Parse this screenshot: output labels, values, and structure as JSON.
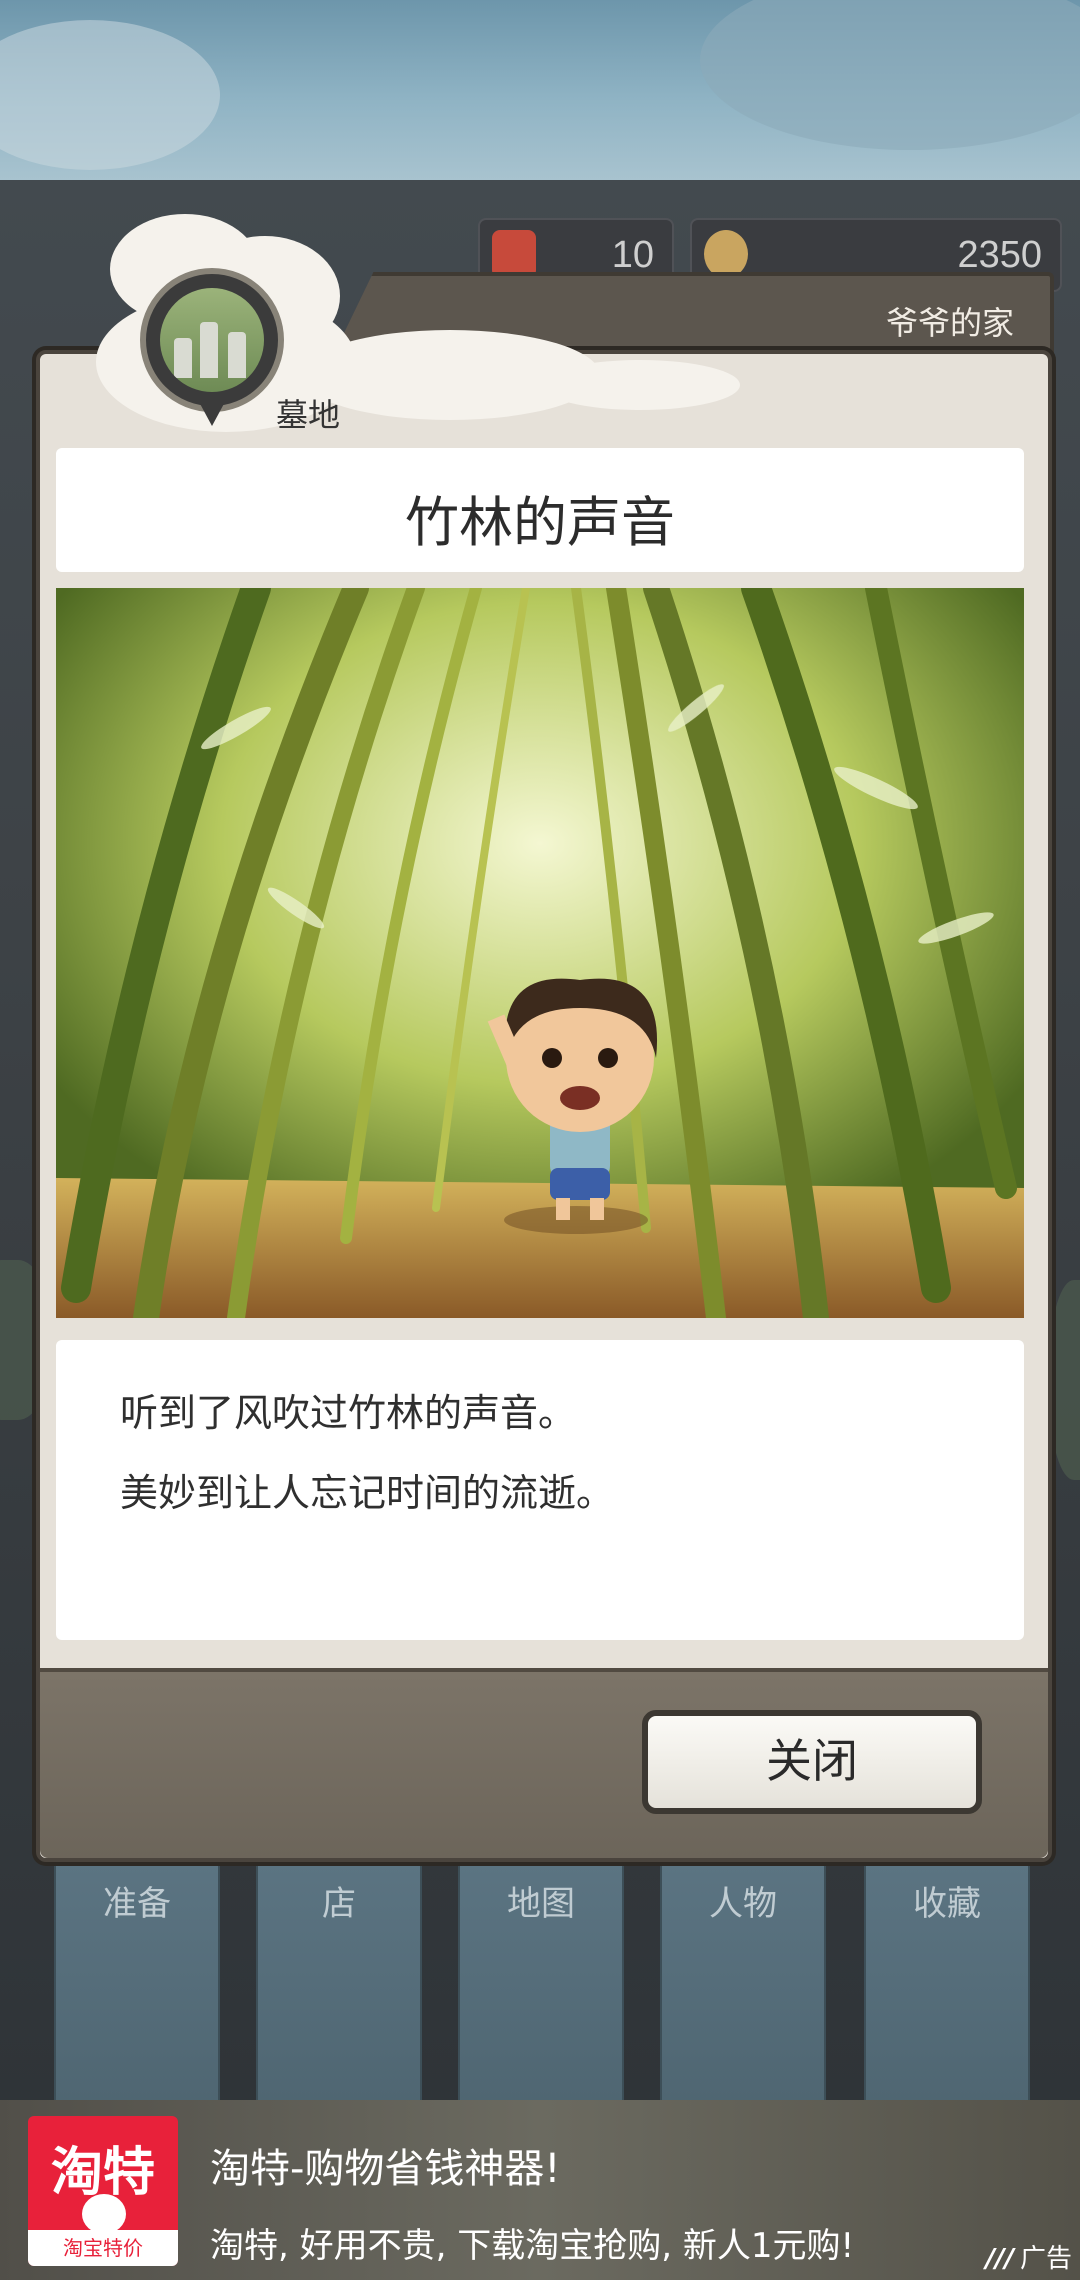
{
  "top_bar": {
    "ticket_count": "10",
    "coin_count": "2350"
  },
  "dialog": {
    "header_location": "爷爷的家",
    "pin_label": "墓地",
    "title": "竹林的声音",
    "description_lines": [
      "听到了风吹过竹林的声音。",
      "美妙到让人忘记时间的流逝。"
    ],
    "close_label": "关闭"
  },
  "bottom_nav": {
    "items": [
      {
        "label": "准备"
      },
      {
        "label": "店"
      },
      {
        "label": "地图"
      },
      {
        "label": "人物"
      },
      {
        "label": "收藏"
      }
    ]
  },
  "ad": {
    "icon_text": "淘特",
    "icon_subtext": "淘宝特价",
    "title": "淘特-购物省钱神器!",
    "description": "淘特, 好用不贵, 下载淘宝抢购, 新人1元购!",
    "tag": "广告"
  },
  "colors": {
    "dialog_bg": "#e6e1d9",
    "dialog_border": "#4a443d",
    "ad_brand": "#e8213a"
  }
}
